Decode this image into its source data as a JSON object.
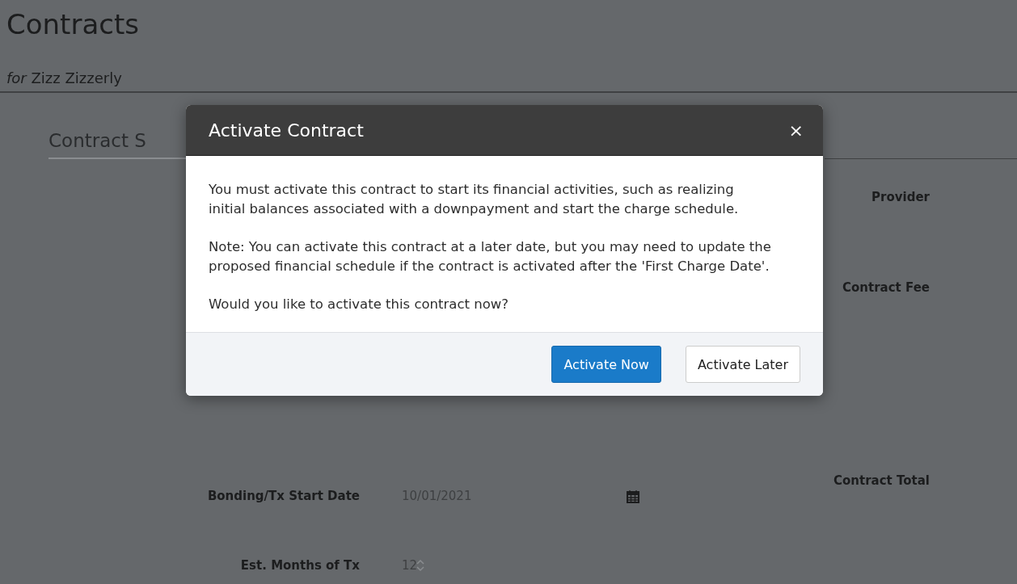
{
  "page": {
    "title": "Contracts",
    "subtitle": "*for* Zizz Zizzerly"
  },
  "tab": {
    "label": "Contract S"
  },
  "form": {
    "left": [
      {
        "label": "Bonding/Tx Start Date",
        "value": "10/01/2021",
        "kind": "date"
      },
      {
        "label": "Est. Months of Tx",
        "value": "12",
        "kind": "number"
      }
    ],
    "right": [
      {
        "label": "Provider"
      },
      {
        "label": "Contract Fee"
      },
      {
        "label": "Contract Total"
      }
    ]
  },
  "dialog": {
    "title": "Activate Contract",
    "close": "×",
    "paragraphs": [
      "You must activate this contract to start its financial activities, such as realizing initial balances associated with a downpayment and start the charge schedule.",
      "Note: You can activate this contract at a later date, but you may need to update the proposed financial schedule if the contract is activated after the 'First Charge Date'.",
      "Would you like to activate this contract now?"
    ],
    "buttons": [
      {
        "label": "Activate Now",
        "kind": "primary"
      },
      {
        "label": "Activate Later",
        "kind": "default"
      }
    ]
  }
}
